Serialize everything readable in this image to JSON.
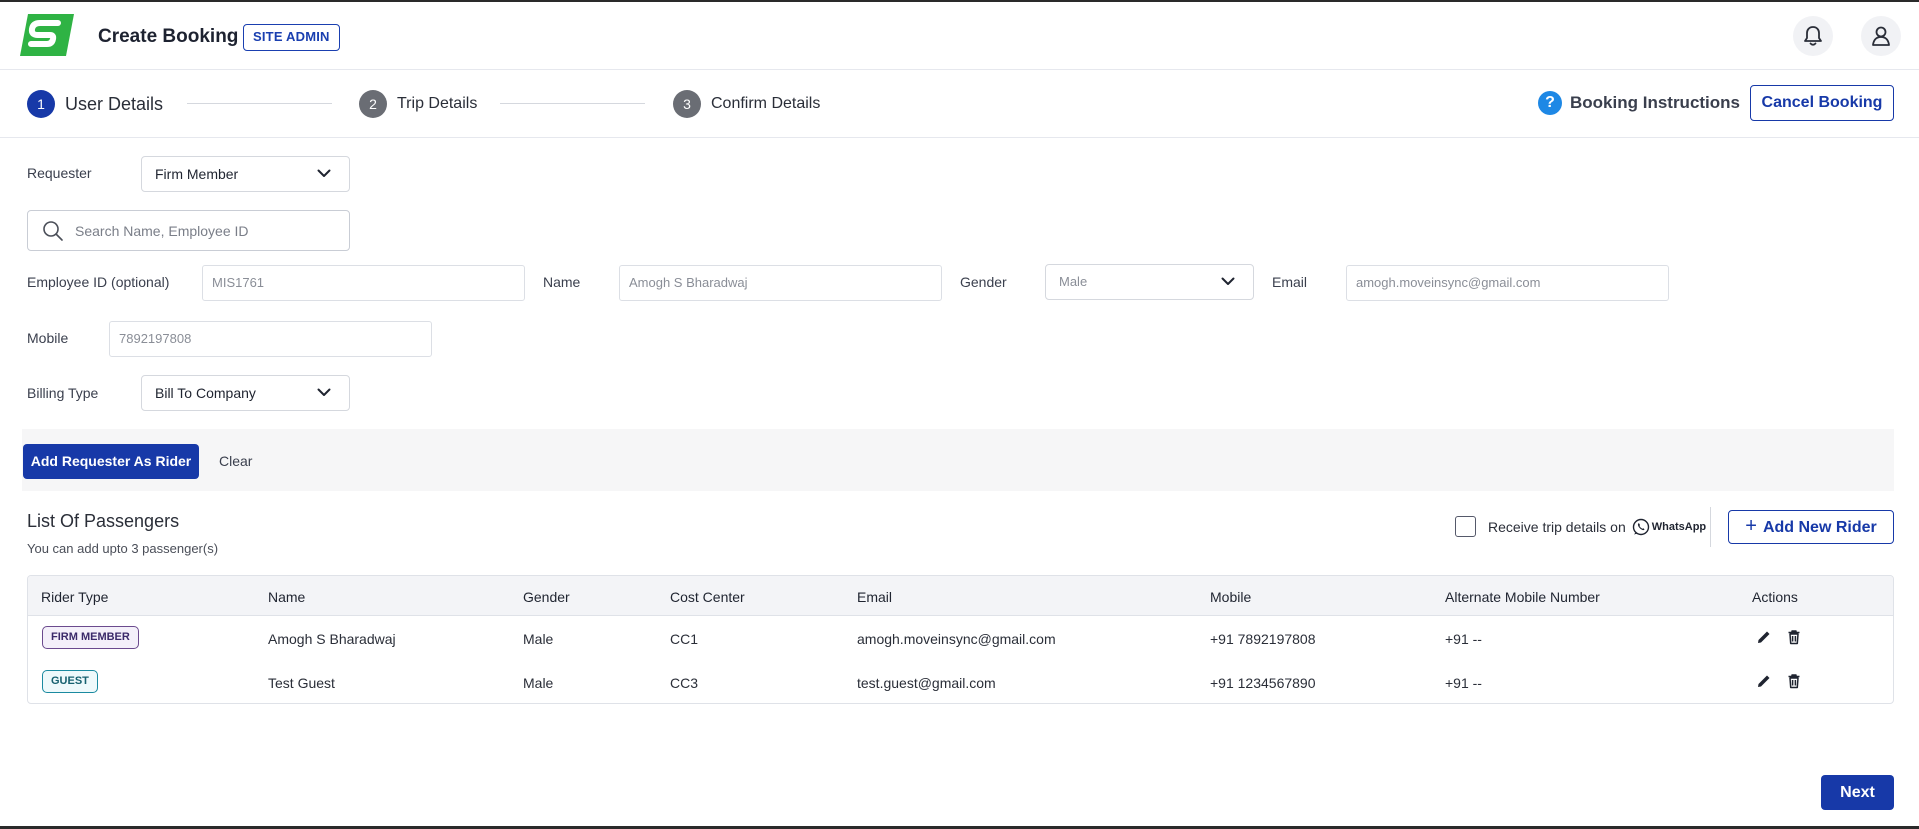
{
  "header": {
    "title": "Create Booking",
    "role_badge": "SITE ADMIN",
    "brand_color": "#2fb344",
    "accent_color": "#1739a8"
  },
  "stepper": {
    "steps": [
      {
        "number": "1",
        "label": "User Details",
        "state": "active"
      },
      {
        "number": "2",
        "label": "Trip Details",
        "state": "pending"
      },
      {
        "number": "3",
        "label": "Confirm Details",
        "state": "pending"
      }
    ],
    "help_label": "Booking Instructions",
    "cancel_label": "Cancel Booking"
  },
  "form": {
    "requester_label": "Requester",
    "requester_value": "Firm Member",
    "search_placeholder": "Search Name, Employee ID",
    "employee_id_label": "Employee ID (optional)",
    "employee_id_value": "MIS1761",
    "name_label": "Name",
    "name_value": "Amogh S Bharadwaj",
    "gender_label": "Gender",
    "gender_value": "Male",
    "email_label": "Email",
    "email_value": "amogh.moveinsync@gmail.com",
    "mobile_label": "Mobile",
    "mobile_value": "7892197808",
    "billing_label": "Billing Type",
    "billing_value": "Bill To Company"
  },
  "actions": {
    "add_requester_label": "Add Requester As Rider",
    "clear_label": "Clear"
  },
  "passengers": {
    "title": "List Of Passengers",
    "subtitle": "You can add upto 3 passenger(s)",
    "whatsapp_text": "Receive trip details on",
    "whatsapp_brand": "WhatsApp",
    "add_rider_label": "Add New Rider",
    "columns": [
      "Rider Type",
      "Name",
      "Gender",
      "Cost Center",
      "Email",
      "Mobile",
      "Alternate Mobile Number",
      "Actions"
    ],
    "rows": [
      {
        "rider_type": "FIRM MEMBER",
        "name": "Amogh S Bharadwaj",
        "gender": "Male",
        "cost_center": "CC1",
        "email": "amogh.moveinsync@gmail.com",
        "mobile": "+91 7892197808",
        "alt_mobile": "+91 --"
      },
      {
        "rider_type": "GUEST",
        "name": "Test Guest",
        "gender": "Male",
        "cost_center": "CC3",
        "email": "test.guest@gmail.com",
        "mobile": "+91 1234567890",
        "alt_mobile": "+91 --"
      }
    ]
  },
  "footer": {
    "next_label": "Next"
  }
}
